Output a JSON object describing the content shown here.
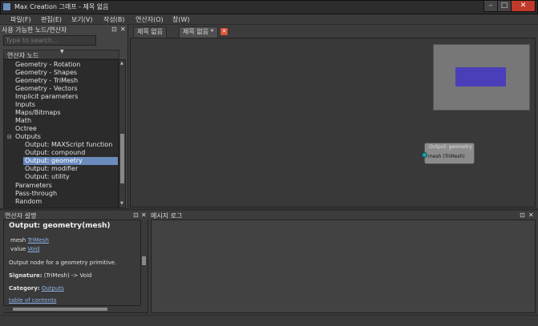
{
  "window": {
    "title": "Max Creation 그래프 - 제목 없음",
    "min_glyph": "–",
    "max_glyph": "□",
    "close_glyph": "✕"
  },
  "menu": [
    {
      "label": "파일(F)"
    },
    {
      "label": "편집(E)"
    },
    {
      "label": "보기(V)"
    },
    {
      "label": "작성(B)"
    },
    {
      "label": "연산자(O)"
    },
    {
      "label": "창(W)"
    }
  ],
  "node_panel": {
    "title": "사용 가능한 노드/연산자",
    "search_placeholder": "Type to search...",
    "column_header": "연산자 노드",
    "sort_glyph": "▼",
    "items": [
      {
        "label": "Geometry - Rotation"
      },
      {
        "label": "Geometry - Shapes"
      },
      {
        "label": "Geometry - TriMesh"
      },
      {
        "label": "Geometry - Vectors"
      },
      {
        "label": "Implicit parameters"
      },
      {
        "label": "Inputs"
      },
      {
        "label": "Maps/Bitmaps"
      },
      {
        "label": "Math"
      },
      {
        "label": "Octree"
      },
      {
        "label": "Outputs",
        "expand": "⊟"
      },
      {
        "label": "Output: MAXScript function"
      },
      {
        "label": "Output: compound"
      },
      {
        "label": "Output: geometry"
      },
      {
        "label": "Output: modifier"
      },
      {
        "label": "Output: utility"
      },
      {
        "label": "Parameters"
      },
      {
        "label": "Pass-through"
      },
      {
        "label": "Random"
      }
    ],
    "selected_label": "Output: geometry"
  },
  "tabs": [
    {
      "label": "제목 없음"
    },
    {
      "label": "제목 없음 *"
    }
  ],
  "graph_node": {
    "title": "Output: geometry",
    "port_label": "mesh (TriMesh)"
  },
  "help_panel": {
    "title": "연산자 설명",
    "heading": "Output: geometry(mesh)",
    "param1_name": "mesh",
    "param1_type": "TriMesh",
    "param2_name": "value",
    "param2_type": "Void",
    "description": "Output node for a geometry primitive.",
    "signature_label": "Signature:",
    "signature_value": "(TriMesh) -> Void",
    "category_label": "Category:",
    "category_value": "Outputs",
    "toc_link": "table of contents"
  },
  "message_panel": {
    "title": "메시지 로그"
  },
  "colors": {
    "selection": "#6b8bbd",
    "tab_close": "#d8553a",
    "minimap_node": "#4a3fb8",
    "port": "#19a3a8",
    "window_close": "#c0392b"
  }
}
